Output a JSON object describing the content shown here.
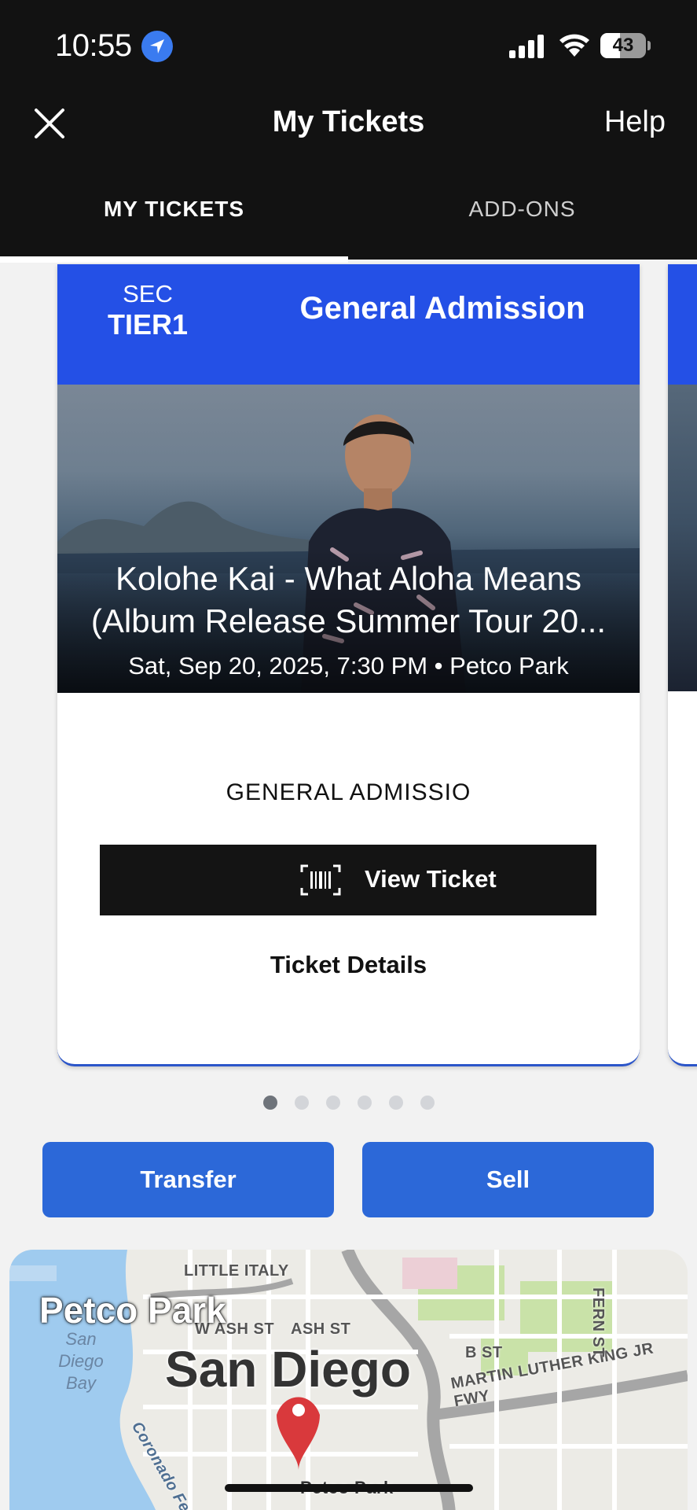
{
  "status_bar": {
    "time": "10:55",
    "battery": "43",
    "battery_level": 0.43
  },
  "header": {
    "title": "My Tickets",
    "help": "Help"
  },
  "tabs": [
    {
      "label": "MY TICKETS",
      "active": true
    },
    {
      "label": "ADD-ONS",
      "active": false
    }
  ],
  "ticket": {
    "section_label": "SEC",
    "section_value": "TIER1",
    "admission_title": "General Admission",
    "event_name": "Kolohe Kai - What Aloha Means (Album Release Summer Tour 20...",
    "event_meta": "Sat, Sep 20, 2025, 7:30 PM • Petco Park",
    "admission_text": "GENERAL ADMISSIO",
    "view_ticket": "View Ticket",
    "details": "Ticket Details"
  },
  "pager": {
    "count": 6,
    "active_index": 0
  },
  "actions": {
    "transfer": "Transfer",
    "sell": "Sell"
  },
  "map": {
    "title": "Petco Park",
    "city": "San Diego",
    "labels": {
      "little_italy": "LITTLE ITALY",
      "wash_st": "W ASH ST",
      "ash_st": "ASH ST",
      "b_st": "B ST",
      "mlk": "MARTIN LUTHER KING JR FWY",
      "fern_st": "FERN ST",
      "coronado": "Coronado Fer",
      "bay": "San Diego Bay",
      "pin_label": "Petco Park"
    }
  },
  "colors": {
    "brand_blue": "#2450e6",
    "action_blue": "#2c68d8",
    "header_bg": "#121212"
  }
}
